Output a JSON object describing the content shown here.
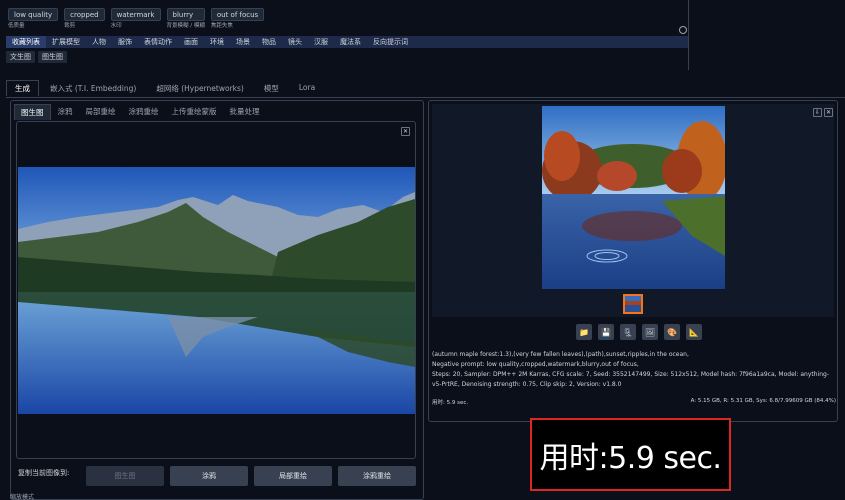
{
  "negative_tags": [
    {
      "label": "low quality",
      "caption": "低质量"
    },
    {
      "label": "cropped",
      "caption": "裁剪"
    },
    {
      "label": "watermark",
      "caption": "水印"
    },
    {
      "label": "blurry",
      "caption": "背景模糊 / 模糊"
    },
    {
      "label": "out of focus",
      "caption": "焦距失焦"
    }
  ],
  "categories": [
    "收藏列表",
    "扩展模型",
    "人物",
    "服饰",
    "表情动作",
    "画面",
    "环境",
    "场景",
    "物品",
    "镜头",
    "汉服",
    "魔法系",
    "反向提示词"
  ],
  "sub_tabs": [
    "文生图",
    "图生图"
  ],
  "main_tabs": [
    "生成",
    "嵌入式 (T.I. Embedding)",
    "超网络 (Hypernetworks)",
    "模型",
    "Lora"
  ],
  "img_tabs": [
    "图生图",
    "涂鸦",
    "局部重绘",
    "涂鸦重绘",
    "上传重绘蒙版",
    "批量处理"
  ],
  "copy": {
    "label": "复制当前图像到:",
    "buttons": [
      "图生图",
      "涂鸦",
      "局部重绘",
      "涂鸦重绘"
    ]
  },
  "bottom_label": "缩放模式",
  "info": {
    "prompt": "(autumn maple forest:1.3),(very few fallen leaves),(path),sunset,ripples,in the ocean,",
    "negative": "Negative prompt: low quality,cropped,watermark,blurry,out of focus,",
    "params": "Steps: 20, Sampler: DPM++ 2M Karras, CFG scale: 7, Seed: 3552147499, Size: 512x512, Model hash: 7f96a1a9ca, Model: anything-v5-PrtRE, Denoising strength: 0.75, Clip skip: 2, Version: v1.8.0"
  },
  "time_left": "用时: 5.9 sec.",
  "time_right": "A: 5.15 GB, R: 5.31 GB, Sys: 6.8/7.99609 GB (84.4%)",
  "highlight_time": "用时:5.9 sec.",
  "close_symbol": "✕",
  "tool_icons": [
    "folder-icon",
    "save-icon",
    "zip-icon",
    "image-icon",
    "palette-icon",
    "ruler-icon"
  ],
  "colors": {
    "accent": "#f97316",
    "highlight_border": "#dc2626",
    "category_bar": "#1e2a4a"
  }
}
